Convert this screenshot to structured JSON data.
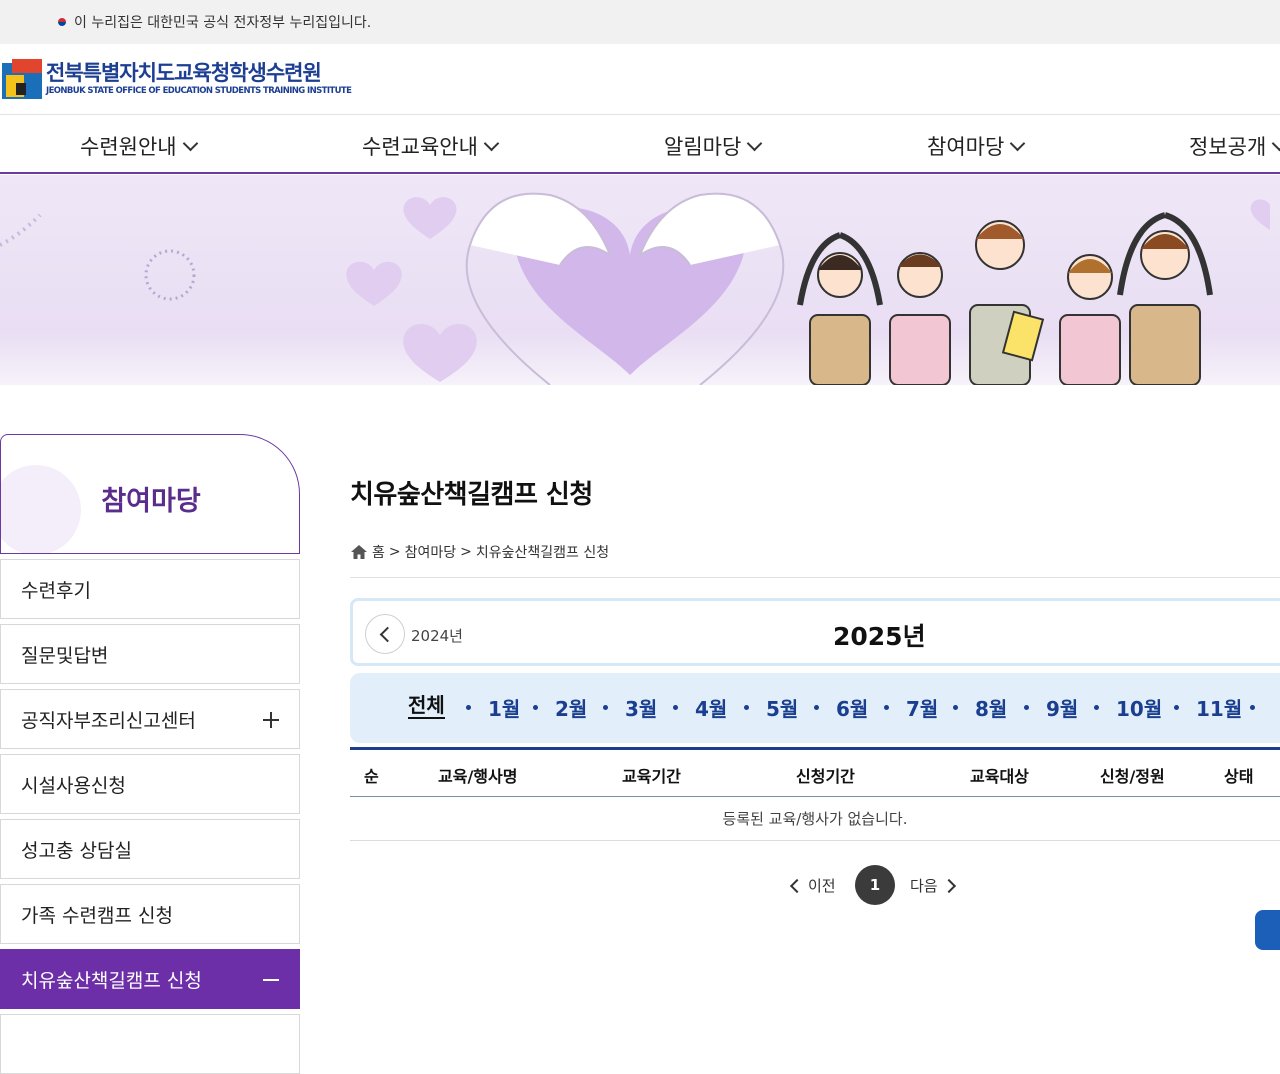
{
  "gov_banner": {
    "text": "이 누리집은 대한민국 공식 전자정부 누리집입니다."
  },
  "logo": {
    "name_ko": "전북특별자치도교육청학생수련원",
    "name_en": "JEONBUK STATE OFFICE OF EDUCATION STUDENTS TRAINING INSTITUTE"
  },
  "gnb": {
    "items": [
      "수련원안내",
      "수련교육안내",
      "알림마당",
      "참여마당",
      "정보공개"
    ]
  },
  "sidebar": {
    "title": "참여마당",
    "items": [
      {
        "label": "수련후기"
      },
      {
        "label": "질문및답변"
      },
      {
        "label": "공직자부조리신고센터",
        "expand": "plus"
      },
      {
        "label": "시설사용신청"
      },
      {
        "label": "성고충 상담실"
      },
      {
        "label": "가족 수련캠프 신청"
      },
      {
        "label": "치유숲산책길캠프 신청",
        "active": true,
        "expand": "minus"
      }
    ]
  },
  "page": {
    "title": "치유숲산책길캠프 신청",
    "breadcrumb": [
      "홈",
      "참여마당",
      "치유숲산책길캠프 신청"
    ],
    "breadcrumb_sep": ">"
  },
  "year_nav": {
    "prev_year": "2024년",
    "current_year": "2025년"
  },
  "months": [
    "전체",
    "1월",
    "2월",
    "3월",
    "4월",
    "5월",
    "6월",
    "7월",
    "8월",
    "9월",
    "10월",
    "11월"
  ],
  "table": {
    "headers": [
      "순",
      "교육/행사명",
      "교육기간",
      "신청기간",
      "교육대상",
      "신청/정원",
      "상태"
    ],
    "empty_message": "등록된 교육/행사가 없습니다."
  },
  "pagination": {
    "prev": "이전",
    "next": "다음",
    "current": "1"
  },
  "colors": {
    "primary": "#6c2fa8",
    "navy": "#1b3f8f",
    "month_bg": "#e2effb"
  }
}
